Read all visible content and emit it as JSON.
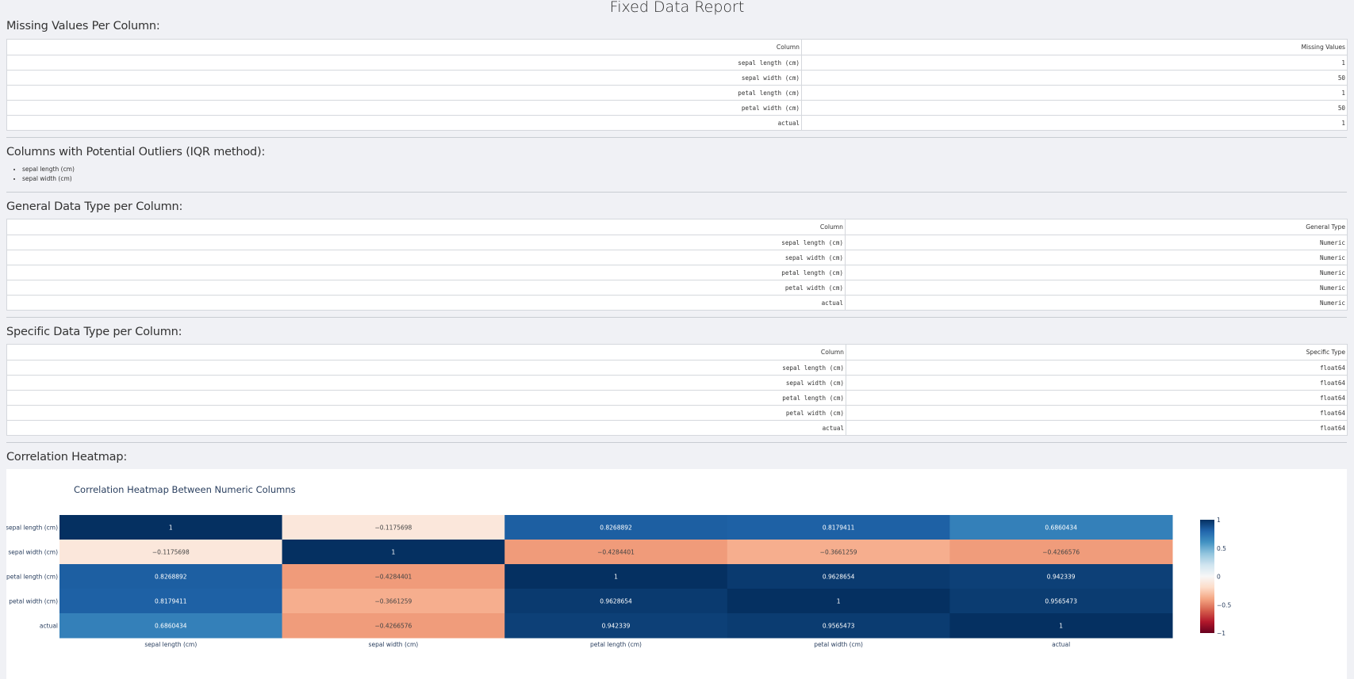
{
  "report_title": "Fixed Data Report",
  "missing": {
    "heading": "Missing Values Per Column:",
    "col_header": "Column",
    "val_header": "Missing Values",
    "rows": [
      {
        "column": "sepal length (cm)",
        "value": "1"
      },
      {
        "column": "sepal width (cm)",
        "value": "50"
      },
      {
        "column": "petal length (cm)",
        "value": "1"
      },
      {
        "column": "petal width (cm)",
        "value": "50"
      },
      {
        "column": "actual",
        "value": "1"
      }
    ]
  },
  "outliers": {
    "heading": "Columns with Potential Outliers (IQR method):",
    "items": [
      "sepal length (cm)",
      "sepal width (cm)"
    ]
  },
  "general_types": {
    "heading": "General Data Type per Column:",
    "col_header": "Column",
    "val_header": "General Type",
    "rows": [
      {
        "column": "sepal length (cm)",
        "value": "Numeric"
      },
      {
        "column": "sepal width (cm)",
        "value": "Numeric"
      },
      {
        "column": "petal length (cm)",
        "value": "Numeric"
      },
      {
        "column": "petal width (cm)",
        "value": "Numeric"
      },
      {
        "column": "actual",
        "value": "Numeric"
      }
    ]
  },
  "specific_types": {
    "heading": "Specific Data Type per Column:",
    "col_header": "Column",
    "val_header": "Specific Type",
    "rows": [
      {
        "column": "sepal length (cm)",
        "value": "float64"
      },
      {
        "column": "sepal width (cm)",
        "value": "float64"
      },
      {
        "column": "petal length (cm)",
        "value": "float64"
      },
      {
        "column": "petal width (cm)",
        "value": "float64"
      },
      {
        "column": "actual",
        "value": "float64"
      }
    ]
  },
  "heatmap_heading": "Correlation Heatmap:",
  "chart_data": {
    "type": "heatmap",
    "title": "Correlation Heatmap Between Numeric Columns",
    "x_categories": [
      "sepal length (cm)",
      "sepal width (cm)",
      "petal length (cm)",
      "petal width (cm)",
      "actual"
    ],
    "y_categories": [
      "sepal length (cm)",
      "sepal width (cm)",
      "petal length (cm)",
      "petal width (cm)",
      "actual"
    ],
    "values": [
      [
        1,
        -0.1175698,
        0.8268892,
        0.8179411,
        0.6860434
      ],
      [
        -0.1175698,
        1,
        -0.4284401,
        -0.3661259,
        -0.4266576
      ],
      [
        0.8268892,
        -0.4284401,
        1,
        0.9628654,
        0.942339
      ],
      [
        0.8179411,
        -0.3661259,
        0.9628654,
        1,
        0.9565473
      ],
      [
        0.6860434,
        -0.4266576,
        0.942339,
        0.9565473,
        1
      ]
    ],
    "cell_labels": [
      [
        "1",
        "−0.1175698",
        "0.8268892",
        "0.8179411",
        "0.6860434"
      ],
      [
        "−0.1175698",
        "1",
        "−0.4284401",
        "−0.3661259",
        "−0.4266576"
      ],
      [
        "0.8268892",
        "−0.4284401",
        "1",
        "0.9628654",
        "0.942339"
      ],
      [
        "0.8179411",
        "−0.3661259",
        "0.9628654",
        "1",
        "0.9565473"
      ],
      [
        "0.6860434",
        "−0.4266576",
        "0.942339",
        "0.9565473",
        "1"
      ]
    ],
    "zlim": [
      -1,
      1
    ],
    "colorscale": "RdBu",
    "colorbar_ticks": [
      "1",
      "0.5",
      "0",
      "−0.5",
      "−1"
    ],
    "colorbar_tick_values": [
      1,
      0.5,
      0,
      -0.5,
      -1
    ]
  }
}
